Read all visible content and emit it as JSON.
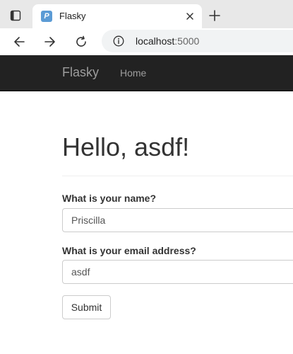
{
  "browser": {
    "tab_title": "Flasky",
    "address": {
      "host": "localhost",
      "port": ":5000"
    },
    "icons": {
      "window": "window-icon",
      "favicon": "flask-favicon-icon",
      "close": "close-icon",
      "new_tab": "plus-icon",
      "back": "arrow-left-icon",
      "forward": "arrow-right-icon",
      "reload": "reload-icon",
      "info": "info-icon"
    },
    "favicon_glyph": "P"
  },
  "navbar": {
    "brand": "Flasky",
    "links": [
      {
        "label": "Home"
      }
    ],
    "background": "#222222"
  },
  "main": {
    "heading": "Hello, asdf!",
    "form": {
      "name_label": "What is your name?",
      "name_value": "Priscilla",
      "email_label": "What is your email address?",
      "email_value": "asdf",
      "submit_label": "Submit"
    }
  }
}
